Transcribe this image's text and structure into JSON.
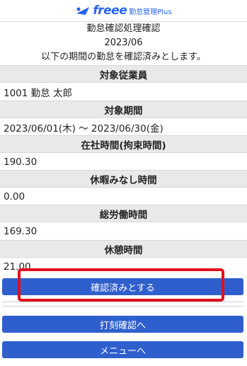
{
  "header": {
    "logo_brand": "freee",
    "logo_product": "勤怠管理Plus"
  },
  "intro": {
    "title": "勤怠確認処理確認",
    "period": "2023/06",
    "message": "以下の期間の勤怠を確認済みとします。"
  },
  "fields": [
    {
      "label": "対象従業員",
      "value": "1001 勤怠 太郎"
    },
    {
      "label": "対象期間",
      "value": "2023/06/01(木) ～ 2023/06/30(金)"
    },
    {
      "label": "在社時間(拘束時間)",
      "value": "190.30"
    },
    {
      "label": "休暇みなし時間",
      "value": "0.00"
    },
    {
      "label": "総労働時間",
      "value": "169.30"
    },
    {
      "label": "休憩時間",
      "value": "21.00"
    }
  ],
  "buttons": {
    "confirm": "確認済みとする",
    "punch_check": "打刻確認へ",
    "menu": "メニューへ"
  },
  "colors": {
    "brand": "#2864f0",
    "button": "#2f5fcd",
    "highlight": "#e0101c",
    "label_bg": "#e9e9e9"
  }
}
